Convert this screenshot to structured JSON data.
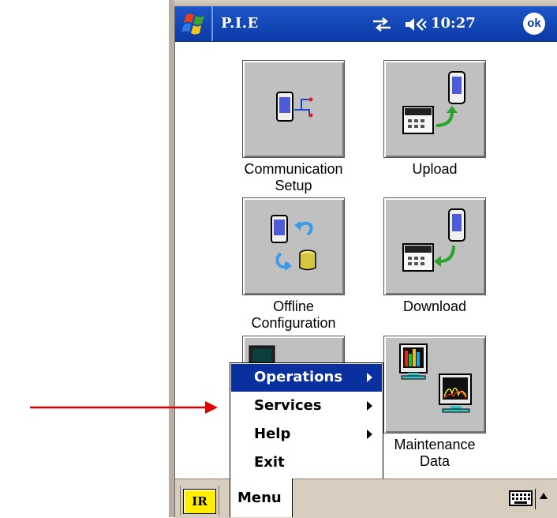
{
  "titlebar": {
    "app_title": "P.I.E",
    "clock": "10:27",
    "ok_label": "ok",
    "start_icon": "windows-flag-icon",
    "connectivity_icon": "connectivity-icon",
    "volume_icon": "volume-icon"
  },
  "tiles": [
    {
      "label": "Communication Setup",
      "icon": "pda-network-icon"
    },
    {
      "label": "Upload",
      "icon": "upload-icon"
    },
    {
      "label": "Offline Configuration",
      "icon": "offline-config-icon"
    },
    {
      "label": "Download",
      "icon": "download-icon"
    },
    {
      "label": "Maintenance Data",
      "icon": "maintenance-data-icon"
    }
  ],
  "menu": {
    "items": [
      {
        "label": "Operations",
        "submenu": true,
        "selected": true
      },
      {
        "label": "Services",
        "submenu": true,
        "selected": false
      },
      {
        "label": "Help",
        "submenu": true,
        "selected": false
      },
      {
        "label": "Exit",
        "submenu": false,
        "selected": false
      }
    ]
  },
  "taskbar": {
    "ir_label": "IR",
    "menu_label": "Menu",
    "keyboard_icon": "keyboard-icon"
  },
  "colors": {
    "titlebar": "#0b3aa6",
    "selection": "#0a2f9e",
    "annotation_arrow": "#e00000",
    "ir_button": "#ffee00"
  }
}
